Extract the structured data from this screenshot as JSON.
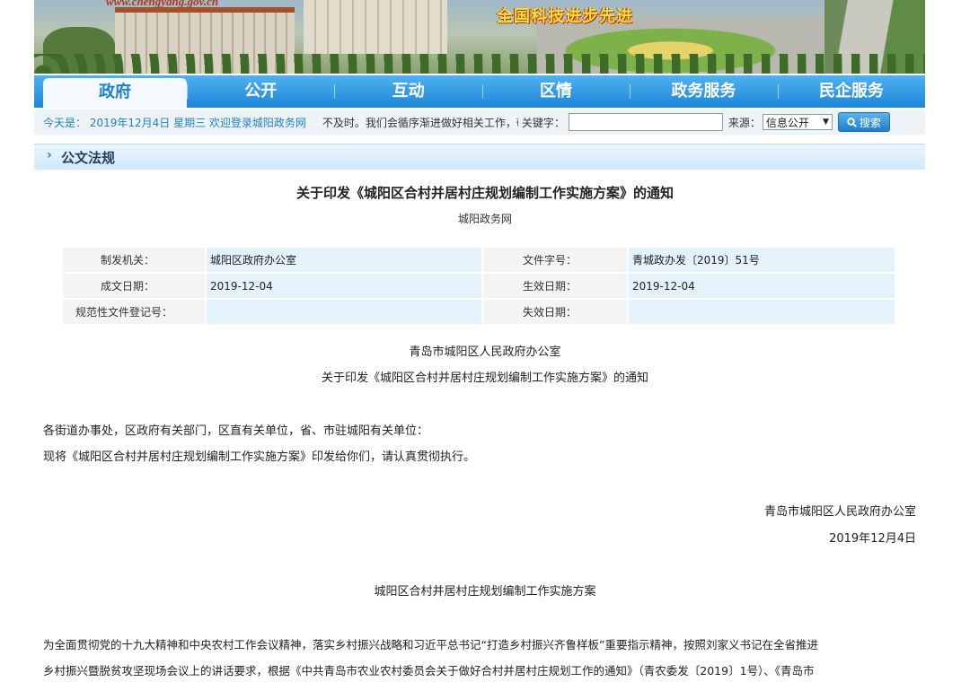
{
  "banner": {
    "site_url": "www.chengyang.gov.cn",
    "slogan": "全国科技进步先进"
  },
  "nav": {
    "items": [
      "政府",
      "公开",
      "互动",
      "区情",
      "政务服务",
      "民企服务"
    ],
    "active": "政府"
  },
  "infobar": {
    "today": "今天是： 2019年12月4日 星期三 欢迎登录城阳政务网",
    "marquee": "不及时。我们会循序渐进做好相关工作，敬",
    "keyword_label": "关键字：",
    "keyword_value": "",
    "source_label": "来源：",
    "source_selected": "信息公开",
    "search_label": "搜索"
  },
  "section": {
    "title": "公文法规"
  },
  "document": {
    "title": "关于印发《城阳区合村并居村庄规划编制工作实施方案》的通知",
    "source": "城阳政务网",
    "meta": {
      "issuer_label": "制发机关：",
      "issuer": "城阳区政府办公室",
      "docno_label": "文件字号：",
      "docno": "青城政办发〔2019〕51号",
      "date_label": "成文日期：",
      "date": "2019-12-04",
      "effective_label": "生效日期：",
      "effective": "2019-12-04",
      "reg_label": "规范性文件登记号：",
      "reg": "",
      "expiry_label": "失效日期：",
      "expiry": ""
    },
    "heading1": "青岛市城阳区人民政府办公室",
    "heading2": "关于印发《城阳区合村并居村庄规划编制工作实施方案》的通知",
    "recipients": "各街道办事处，区政府有关部门，区直有关单位，省、市驻城阳有关单位：",
    "line1": "现将《城阳区合村并居村庄规划编制工作实施方案》印发给你们，请认真贯彻执行。",
    "signature": "青岛市城阳区人民政府办公室",
    "sign_date": "2019年12月4日",
    "plan_title": "城阳区合村并居村庄规划编制工作实施方案",
    "para1": "为全面贯彻党的十九大精神和中央农村工作会议精神，落实乡村振兴战略和习近平总书记“打造乡村振兴齐鲁样板”重要指示精神，按照刘家义书记在全省推进",
    "para2": "乡村振兴暨脱贫攻坚现场会议上的讲话要求，根据《中共青岛市农业农村委员会关于做好合村并居村庄规划工作的通知》（青农委发〔2019〕1号）、《青岛市"
  }
}
